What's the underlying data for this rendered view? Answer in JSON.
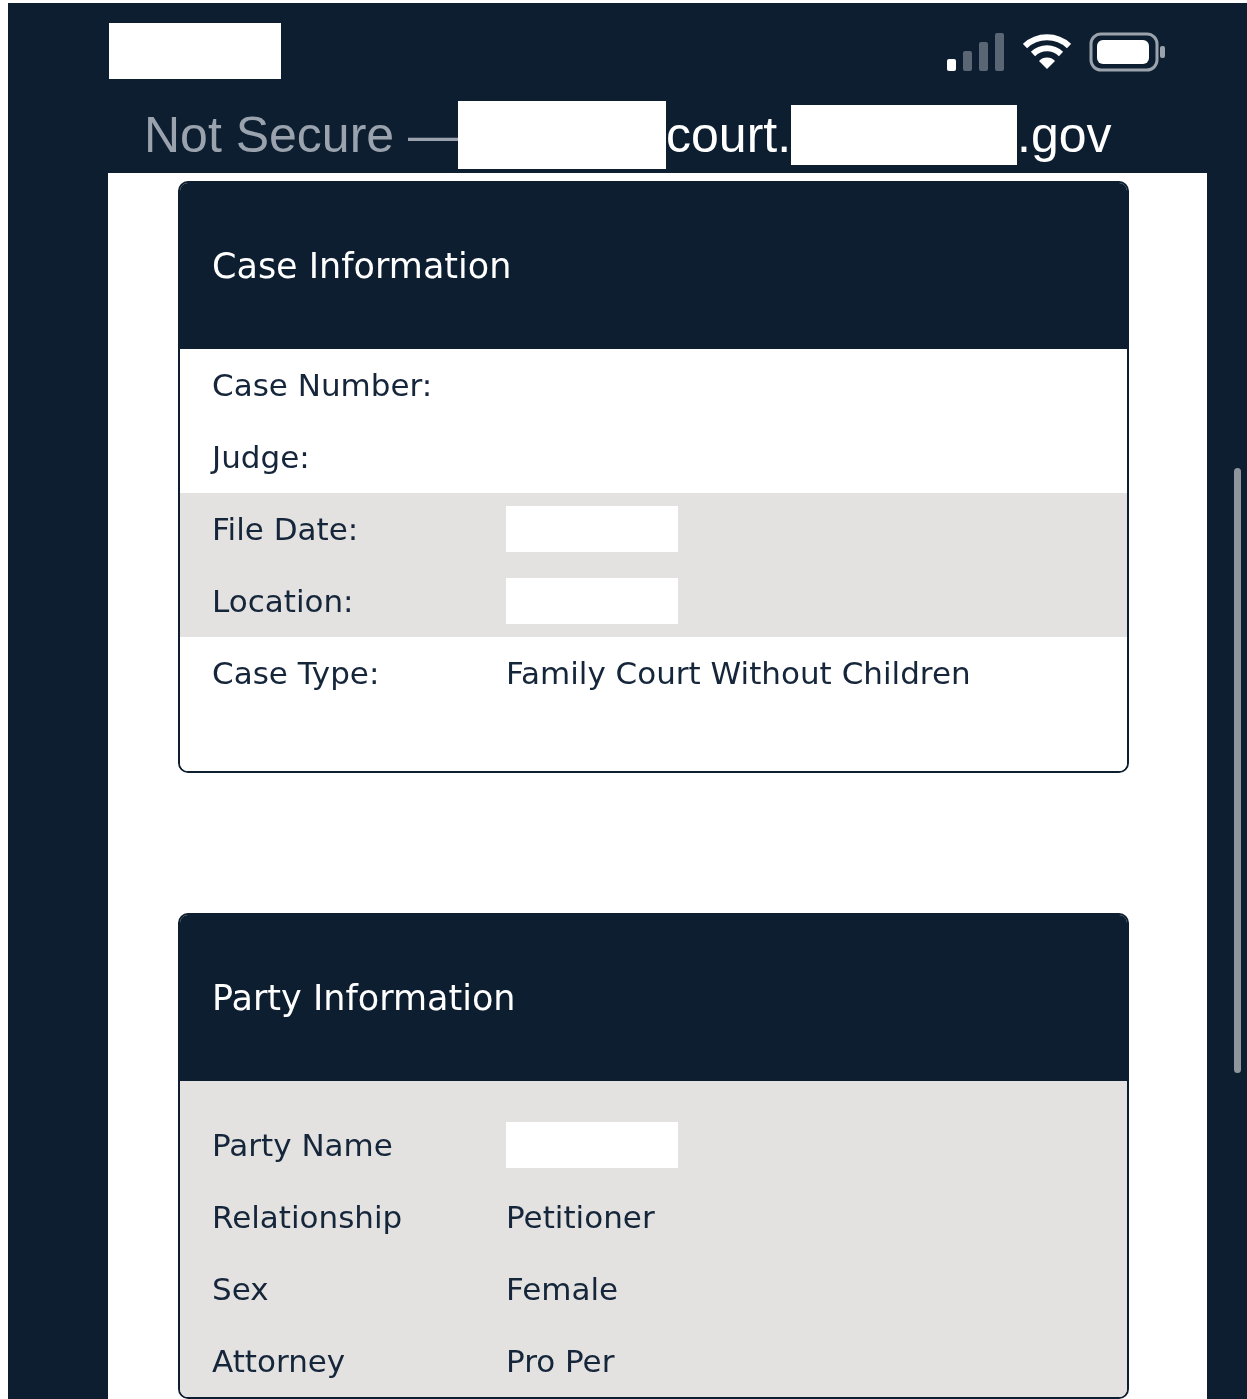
{
  "status_bar": {
    "time_redacted": true
  },
  "address_bar": {
    "security": "Not Secure —",
    "parts": [
      {
        "redacted": true
      },
      {
        "text": "court.",
        "redacted": false
      },
      {
        "redacted": true
      },
      {
        "text": ".gov",
        "redacted": false
      }
    ]
  },
  "sections": [
    {
      "title": "Case Information",
      "shaded": false,
      "rows": [
        {
          "label": "Case Number:",
          "shaded": false
        },
        {
          "label": "Judge:",
          "shaded": false
        },
        {
          "label": "File Date:",
          "redacted": true,
          "shaded": true
        },
        {
          "label": "Location:",
          "redacted": true,
          "shaded": true
        },
        {
          "label": "Case Type:",
          "value": "Family Court Without Children",
          "shaded": false
        }
      ]
    },
    {
      "title": "Party Information",
      "shaded": true,
      "rows": [
        {
          "label": "Party Name",
          "redacted": true
        },
        {
          "label": "Relationship",
          "value": "Petitioner"
        },
        {
          "label": "Sex",
          "value": "Female"
        },
        {
          "label": "Attorney",
          "value": "Pro Per"
        }
      ]
    }
  ]
}
